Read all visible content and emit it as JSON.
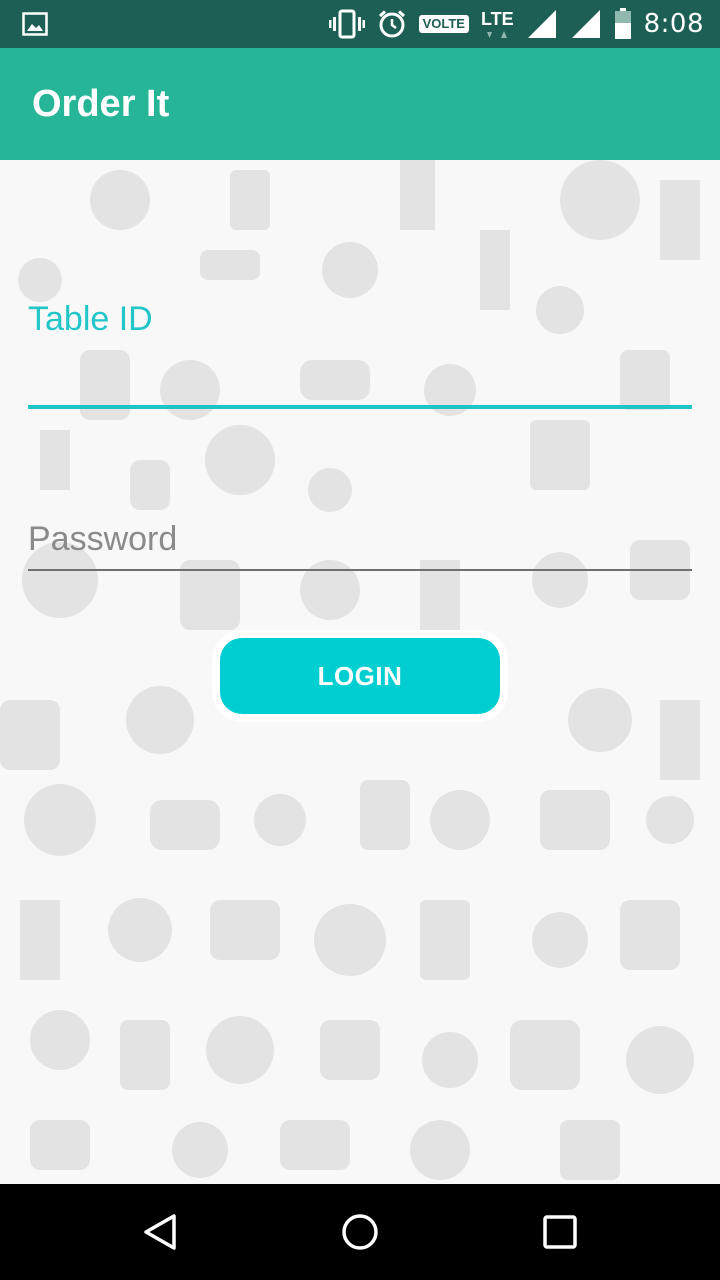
{
  "status_bar": {
    "time": "8:08",
    "volte": "VOLTE",
    "lte": "LTE",
    "icons": [
      "image-icon",
      "vibrate-icon",
      "alarm-icon",
      "volte-icon",
      "lte-icon",
      "signal-icon",
      "signal-icon-2",
      "battery-icon"
    ]
  },
  "app_bar": {
    "title": "Order It",
    "color": "#26b597"
  },
  "form": {
    "table_id_label": "Table ID",
    "password_placeholder": "Password",
    "login_label": "LOGIN",
    "accent": "#00ced1"
  },
  "nav_bar": {
    "icons": [
      "back-icon",
      "home-icon",
      "recents-icon"
    ]
  }
}
